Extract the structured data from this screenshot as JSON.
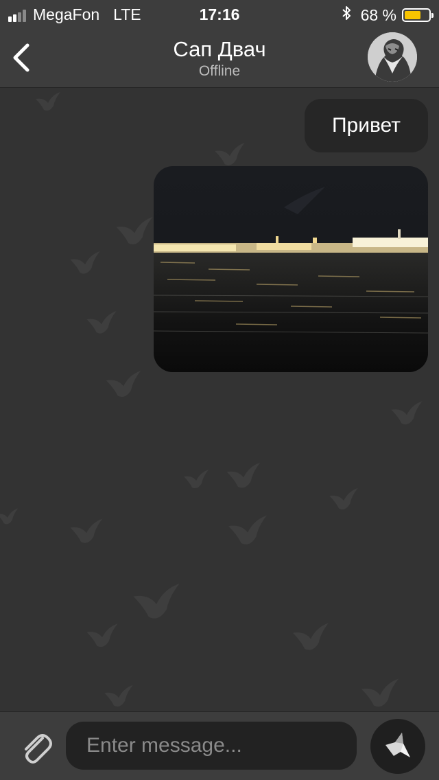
{
  "status_bar": {
    "carrier": "MegaFon",
    "network": "LTE",
    "time": "17:16",
    "battery_percent": "68 %",
    "battery_level": 0.68,
    "signal_bars": 2,
    "icons": [
      "signal-icon",
      "bluetooth-icon",
      "battery-icon"
    ]
  },
  "header": {
    "back_icon": "chevron-left-icon",
    "title": "Сап Двач",
    "subtitle": "Offline",
    "avatar_icon": "avatar-portrait"
  },
  "messages": [
    {
      "type": "text",
      "text": "Привет",
      "outgoing": true
    },
    {
      "type": "image",
      "description_icon": "night-river-photo",
      "outgoing": true
    }
  ],
  "input_bar": {
    "attach_icon": "paperclip-icon",
    "placeholder": "Enter message...",
    "value": "",
    "send_icon": "paper-bird-icon"
  },
  "colors": {
    "bar_background": "#3d3d3d",
    "chat_background": "#333333",
    "bubble_background": "#262626",
    "input_background": "#222222",
    "battery_fill": "#f8c400",
    "subtitle": "#bdbdbd",
    "placeholder": "#8a8a8a"
  }
}
